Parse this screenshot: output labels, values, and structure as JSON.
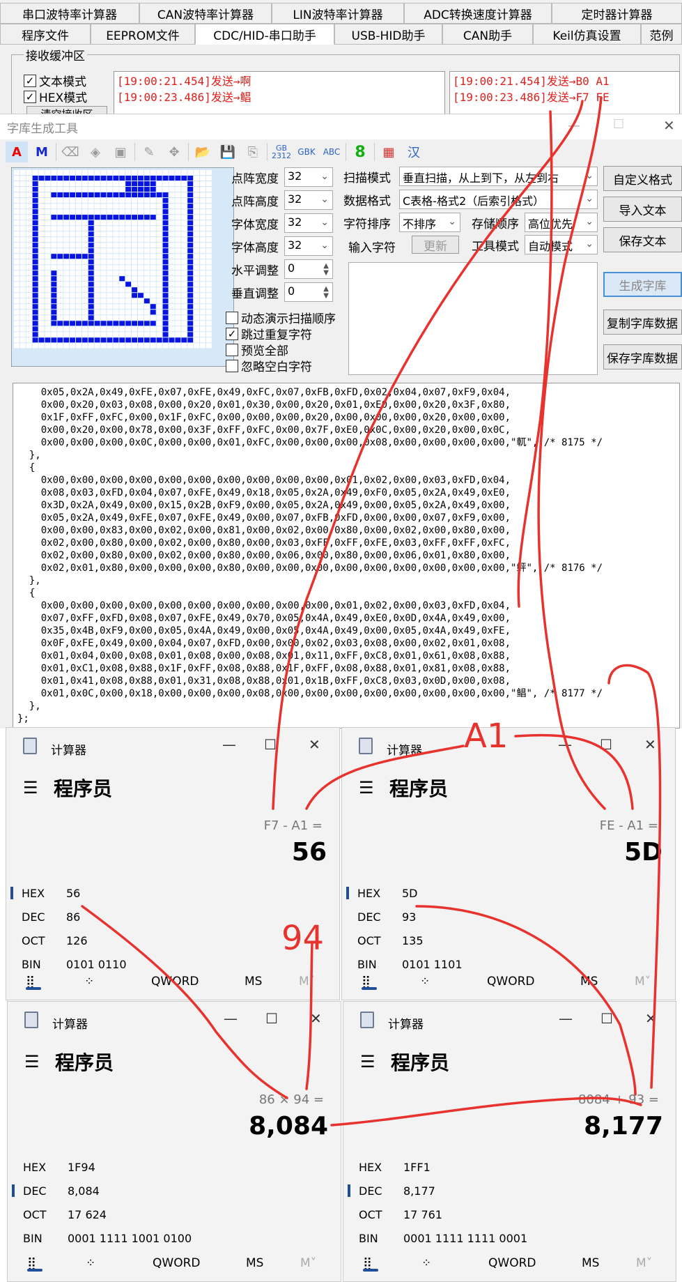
{
  "tabs": {
    "row1": [
      "串口波特率计算器",
      "CAN波特率计算器",
      "LIN波特率计算器",
      "ADC转换速度计算器",
      "定时器计算器"
    ],
    "row2": [
      "程序文件",
      "EEPROM文件",
      "CDC/HID-串口助手",
      "USB-HID助手",
      "CAN助手",
      "Keil仿真设置",
      "范例"
    ]
  },
  "serial": {
    "group_label": "接收缓冲区",
    "text_mode_label": "文本模式",
    "hex_mode_label": "HEX模式",
    "clear_label": "清空接收区",
    "log_left": [
      "[19:00:21.454]发送→啊",
      "[19:00:23.486]发送→鲳"
    ],
    "log_right": [
      "[19:00:21.454]发送→B0 A1",
      "[19:00:23.486]发送→F7 FE"
    ]
  },
  "fonttool": {
    "title": "字库生成工具",
    "labels": {
      "dot_width": "点阵宽度",
      "dot_height": "点阵高度",
      "font_width": "字体宽度",
      "font_height": "字体高度",
      "h_adjust": "水平调整",
      "v_adjust": "垂直调整",
      "scan_mode": "扫描模式",
      "data_format": "数据格式",
      "char_order": "字符排序",
      "storage_order": "存储顺序",
      "input_char": "输入字符",
      "tool_mode": "工具模式"
    },
    "values": {
      "dot_width": "32",
      "dot_height": "32",
      "font_width": "32",
      "font_height": "32",
      "h_adjust": "0",
      "v_adjust": "0",
      "scan_mode": "垂直扫描，从上到下，从左到右",
      "data_format": "C表格-格式2（后索引格式）",
      "char_order": "不排序",
      "storage_order": "高位优先",
      "tool_mode": "自动模式"
    },
    "update_btn": "更新",
    "checks": [
      "动态演示扫描顺序",
      "跳过重复字符",
      "预览全部",
      "忽略空白字符"
    ],
    "buttons": [
      "自定义格式",
      "导入文本",
      "保存文本",
      "生成字库",
      "复制字库数据",
      "保存字库数据"
    ],
    "code_lines": [
      "    0x05,0x2A,0x49,0xFE,0x07,0xFE,0x49,0xFC,0x07,0xFB,0xFD,0x02,0x04,0x07,0xF9,0x04,",
      "    0x00,0x20,0x03,0x08,0x00,0x20,0x01,0x30,0x00,0x20,0x01,0xE0,0x00,0x20,0x3F,0x80,",
      "    0x1F,0xFF,0xFC,0x00,0x1F,0xFC,0x00,0x00,0x00,0x20,0x00,0x00,0x00,0x20,0x00,0x00,",
      "    0x00,0x20,0x00,0x78,0x00,0x3F,0xFF,0xFC,0x00,0x7F,0xE0,0x0C,0x00,0x20,0x00,0x0C,",
      "    0x00,0x00,0x00,0x0C,0x00,0x00,0x01,0xFC,0x00,0x00,0x00,0x08,0x00,0x00,0x00,0x00,\"軏\", /* 8175 */",
      "  },",
      "  {",
      "    0x00,0x00,0x00,0x00,0x00,0x00,0x00,0x00,0x00,0x00,0x01,0x02,0x00,0x03,0xFD,0x04,",
      "    0x08,0x03,0xFD,0x04,0x07,0xFE,0x49,0x18,0x05,0x2A,0x49,0xF0,0x05,0x2A,0x49,0xE0,",
      "    0x3D,0x2A,0x49,0x00,0x15,0x2B,0xF9,0x00,0x05,0x2A,0x49,0x00,0x05,0x2A,0x49,0x00,",
      "    0x05,0x2A,0x49,0xFE,0x07,0xFE,0x49,0x00,0x07,0xFB,0xFD,0x00,0x00,0x07,0xF9,0x00,",
      "    0x00,0x00,0x83,0x00,0x02,0x00,0x81,0x00,0x02,0x00,0x80,0x00,0x02,0x00,0x80,0x00,",
      "    0x02,0x00,0x80,0x00,0x02,0x00,0x80,0x00,0x03,0xFF,0xFF,0xFE,0x03,0xFF,0xFF,0xFC,",
      "    0x02,0x00,0x80,0x00,0x02,0x00,0x80,0x00,0x06,0x00,0x80,0x00,0x06,0x01,0x80,0x00,",
      "    0x02,0x01,0x80,0x00,0x00,0x00,0x80,0x00,0x00,0x00,0x00,0x00,0x00,0x00,0x00,0x00,\"鲆\", /* 8176 */",
      "  },",
      "  {",
      "    0x00,0x00,0x00,0x00,0x00,0x00,0x00,0x00,0x00,0x00,0x01,0x02,0x00,0x03,0xFD,0x04,",
      "    0x07,0xFF,0xFD,0x08,0x07,0xFE,0x49,0x70,0x05,0x4A,0x49,0xE0,0x0D,0x4A,0x49,0x00,",
      "    0x35,0x4B,0xF9,0x00,0x05,0x4A,0x49,0x00,0x05,0x4A,0x49,0x00,0x05,0x4A,0x49,0xFE,",
      "    0x0F,0xFE,0x49,0x00,0x04,0x07,0xFD,0x00,0x00,0x02,0x03,0x08,0x00,0x02,0x01,0x08,",
      "    0x01,0x04,0x00,0x08,0x01,0x08,0x00,0x08,0x01,0x11,0xFF,0xC8,0x01,0x61,0x08,0x88,",
      "    0x01,0xC1,0x08,0x88,0x1F,0xFF,0x08,0x88,0x1F,0xFF,0x08,0x88,0x01,0x81,0x08,0x88,",
      "    0x01,0x41,0x08,0x88,0x01,0x31,0x08,0x88,0x01,0x1B,0xFF,0xC8,0x03,0x0D,0x00,0x08,",
      "    0x01,0x0C,0x00,0x18,0x00,0x00,0x00,0x08,0x00,0x00,0x00,0x00,0x00,0x00,0x00,0x00,\"鲳\", /* 8177 */",
      "  },",
      "};"
    ]
  },
  "calculators": [
    {
      "title": "计算器",
      "mode": "程序员",
      "expr": "F7 - A1 =",
      "result": "56",
      "hex": "56",
      "dec": "86",
      "oct": "126",
      "bin": "0101 0110",
      "active": "HEX",
      "qword": "QWORD",
      "ms": "MS",
      "m": "M˅"
    },
    {
      "title": "计算器",
      "mode": "程序员",
      "expr": "FE - A1 =",
      "result": "5D",
      "hex": "5D",
      "dec": "93",
      "oct": "135",
      "bin": "0101 1101",
      "active": "HEX",
      "qword": "QWORD",
      "ms": "MS",
      "m": "M˅"
    },
    {
      "title": "计算器",
      "mode": "程序员",
      "expr": "86 × 94 =",
      "result": "8,084",
      "hex": "1F94",
      "dec": "8,084",
      "oct": "17 624",
      "bin": "0001 1111 1001 0100",
      "active": "DEC",
      "qword": "QWORD",
      "ms": "MS",
      "m": "M˅"
    },
    {
      "title": "计算器",
      "mode": "程序员",
      "expr": "8084 + 93 =",
      "result": "8,177",
      "hex": "1FF1",
      "dec": "8,177",
      "oct": "17 761",
      "bin": "0001 1111 1111 0001",
      "active": "DEC",
      "qword": "QWORD",
      "ms": "MS",
      "m": "M˅"
    }
  ],
  "annotations": {
    "a1_label": "A1",
    "n94_label": "94",
    "color": "#e8322e"
  },
  "colors": {
    "pixel_on": "#0a14e0",
    "grid_bg": "#d7e8f8",
    "accent": "#1f4f9a",
    "log_text": "#e0201c"
  }
}
